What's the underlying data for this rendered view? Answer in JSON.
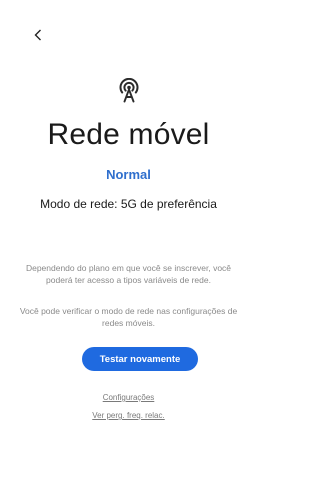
{
  "header": {
    "back_icon": "chevron-left-icon"
  },
  "main": {
    "icon": "antenna-signal-icon",
    "title": "Rede móvel",
    "status": "Normal",
    "mode_text": "Modo de rede: 5G de preferência",
    "info_1": "Dependendo do plano em que você se inscrever, você poderá ter acesso a tipos variáveis de rede.",
    "info_2": "Você pode verificar o modo de rede nas configurações de redes móveis.",
    "retry_label": "Testar novamente",
    "link_settings": "Configurações",
    "link_faq": "Ver perg. freq. relac."
  },
  "colors": {
    "accent": "#2f6fcd",
    "button": "#1f6ae0"
  }
}
